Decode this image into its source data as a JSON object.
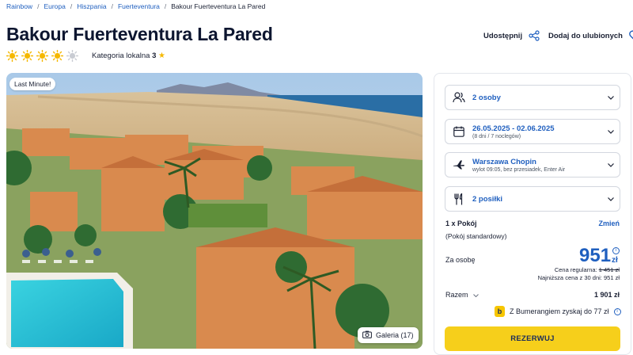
{
  "breadcrumb": {
    "items": [
      "Rainbow",
      "Europa",
      "Hiszpania",
      "Fuerteventura"
    ],
    "current": "Bakour Fuerteventura La Pared",
    "separator": "/"
  },
  "hotel": {
    "title": "Bakour Fuerteventura La Pared",
    "rating_stars": 4,
    "rating_max": 5,
    "category_label": "Kategoria lokalna",
    "category_value": "3",
    "category_star": "★"
  },
  "actions": {
    "share_label": "Udostępnij",
    "favorite_label": "Dodaj do ulubionych"
  },
  "photo": {
    "badge": "Last Minute!",
    "gallery_label": "Galeria (17)"
  },
  "booking": {
    "persons": {
      "label": "2 osoby",
      "icon": "person-icon"
    },
    "dates": {
      "label": "26.05.2025 - 02.06.2025",
      "sub": "(8 dni / 7 noclegów)",
      "icon": "calendar-icon"
    },
    "flight": {
      "label": "Warszawa Chopin",
      "sub": "wylot 09:05, bez przesiadek, Enter Air",
      "icon": "plane-icon"
    },
    "meals": {
      "label": "2 posiłki",
      "icon": "cutlery-icon"
    },
    "room_count": "1 x Pokój",
    "change_label": "Zmień",
    "room_type": "(Pokój standardowy)",
    "per_person_label": "Za osobę",
    "price": "951",
    "currency": "zł",
    "info_icon": "i",
    "regular_label": "Cena regularna:",
    "regular_price": "1 451 zł",
    "lowest_label": "Najniższa cena z 30 dni:",
    "lowest_price": "951 zł",
    "total_label": "Razem",
    "total_value": "1 901 zł",
    "bumerang_logo": "b",
    "bumerang_text": "Z Bumerangiem zyskaj do 77 zł",
    "reserve_label": "REZERWUJ"
  },
  "colors": {
    "accent_blue": "#1f5fbf",
    "sun_yellow": "#f5b800",
    "reserve_yellow": "#f6cf1b",
    "title_navy": "#0d1630"
  }
}
